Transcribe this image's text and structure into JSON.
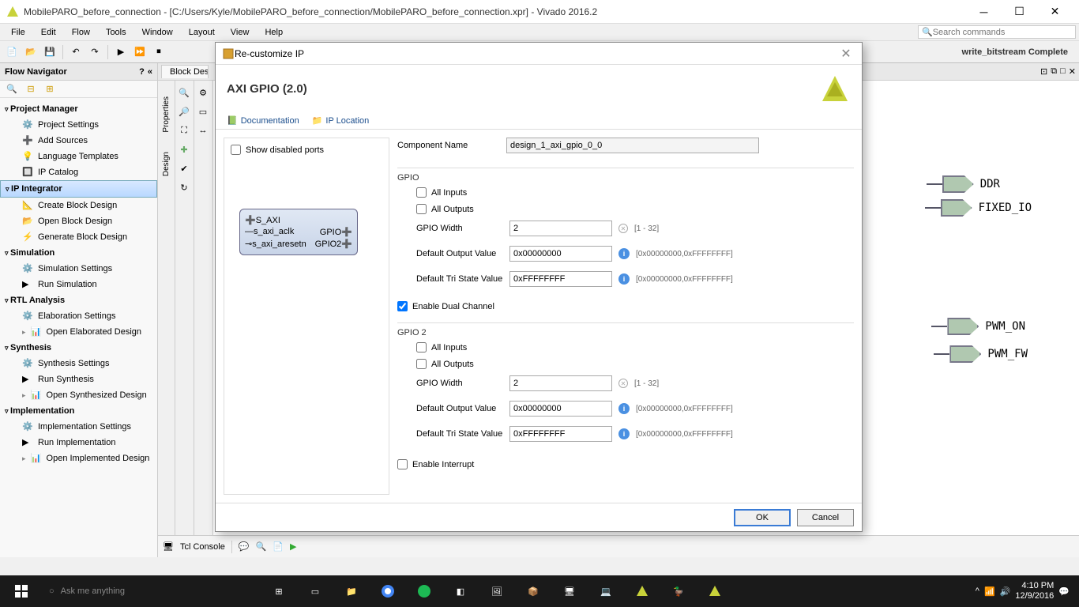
{
  "window": {
    "title": "MobilePARO_before_connection - [C:/Users/Kyle/MobilePARO_before_connection/MobilePARO_before_connection.xpr] - Vivado 2016.2",
    "search_placeholder": "Search commands"
  },
  "menu": {
    "items": [
      "File",
      "Edit",
      "Flow",
      "Tools",
      "Window",
      "Layout",
      "View",
      "Help"
    ]
  },
  "status": {
    "right": "write_bitstream Complete"
  },
  "flownav": {
    "title": "Flow Navigator",
    "sections": [
      {
        "name": "Project Manager",
        "open": true,
        "items": [
          "Project Settings",
          "Add Sources",
          "Language Templates",
          "IP Catalog"
        ]
      },
      {
        "name": "IP Integrator",
        "open": true,
        "sel": true,
        "items": [
          "Create Block Design",
          "Open Block Design",
          "Generate Block Design"
        ]
      },
      {
        "name": "Simulation",
        "open": true,
        "items": [
          "Simulation Settings",
          "Run Simulation"
        ]
      },
      {
        "name": "RTL Analysis",
        "open": true,
        "items": [
          "Elaboration Settings",
          "Open Elaborated Design"
        ]
      },
      {
        "name": "Synthesis",
        "open": true,
        "items": [
          "Synthesis Settings",
          "Run Synthesis",
          "Open Synthesized Design"
        ]
      },
      {
        "name": "Implementation",
        "open": true,
        "items": [
          "Implementation Settings",
          "Run Implementation",
          "Open Implemented Design"
        ]
      }
    ]
  },
  "center": {
    "tab": "Block Design",
    "vtabs": [
      "Properties",
      "Design"
    ],
    "ports": [
      "DDR",
      "FIXED_IO",
      "PWM_ON",
      "PWM_FW"
    ]
  },
  "console": {
    "tab": "Tcl Console"
  },
  "dialog": {
    "title": "Re-customize IP",
    "heading": "AXI GPIO (2.0)",
    "links": [
      "Documentation",
      "IP Location"
    ],
    "show_disabled": "Show disabled ports",
    "comp_name_label": "Component Name",
    "comp_name": "design_1_axi_gpio_0_0",
    "gpio": {
      "title": "GPIO",
      "all_inputs": "All Inputs",
      "all_outputs": "All Outputs",
      "width_label": "GPIO Width",
      "width": "2",
      "width_hint": "[1 - 32]",
      "dov_label": "Default Output Value",
      "dov": "0x00000000",
      "dov_hint": "[0x00000000,0xFFFFFFFF]",
      "dts_label": "Default Tri State Value",
      "dts": "0xFFFFFFFF",
      "dts_hint": "[0x00000000,0xFFFFFFFF]"
    },
    "dual_label": "Enable Dual Channel",
    "gpio2": {
      "title": "GPIO 2",
      "width": "2",
      "dov": "0x00000000",
      "dts": "0xFFFFFFFF"
    },
    "interrupt_label": "Enable Interrupt",
    "ip_preview": {
      "left": [
        "S_AXI",
        "s_axi_aclk",
        "s_axi_aresetn"
      ],
      "right": [
        "GPIO",
        "GPIO2"
      ]
    },
    "ok": "OK",
    "cancel": "Cancel"
  },
  "taskbar": {
    "cortana": "Ask me anything",
    "time": "4:10 PM",
    "date": "12/9/2016"
  }
}
